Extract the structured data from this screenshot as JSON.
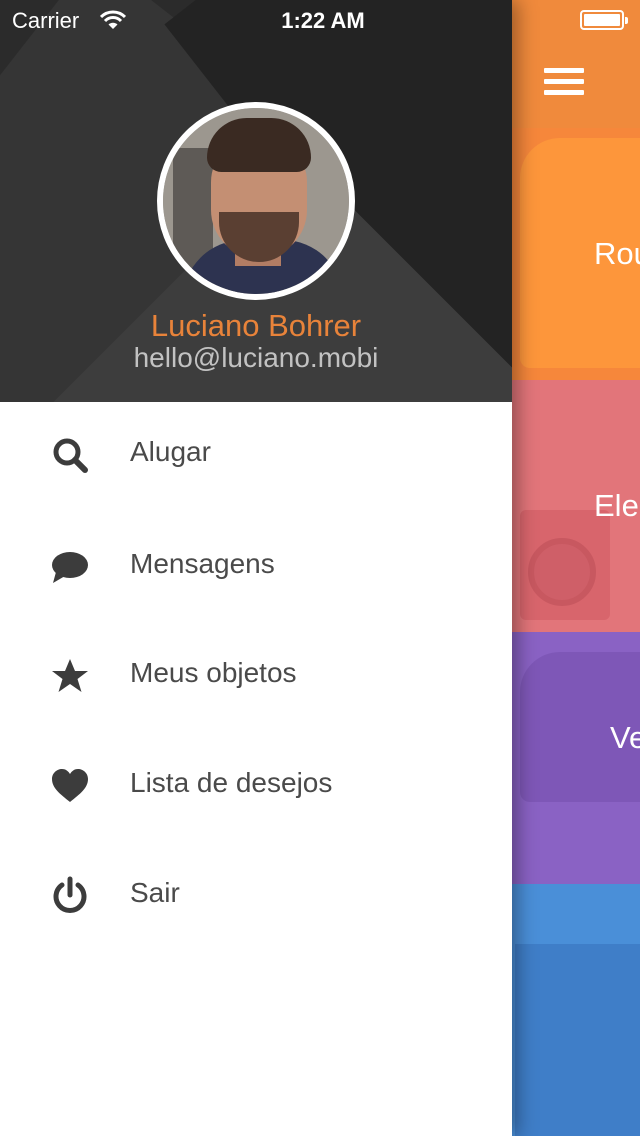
{
  "status_bar": {
    "carrier": "Carrier",
    "time": "1:22 AM"
  },
  "profile": {
    "name": "Luciano Bohrer",
    "email": "hello@luciano.mobi"
  },
  "menu": [
    {
      "label": "Alugar",
      "icon": "search-icon"
    },
    {
      "label": "Mensagens",
      "icon": "chat-bubble-icon"
    },
    {
      "label": "Meus objetos",
      "icon": "star-icon"
    },
    {
      "label": "Lista de desejos",
      "icon": "heart-icon"
    },
    {
      "label": "Sair",
      "icon": "power-icon"
    }
  ],
  "categories": [
    {
      "label": "Rou",
      "color": "#f6873b"
    },
    {
      "label": "Ele",
      "color": "#e2757a"
    },
    {
      "label": "Ve",
      "color": "#8a62c4"
    },
    {
      "label": "",
      "color": "#4a8fd8"
    }
  ],
  "colors": {
    "accent": "#f08a3c",
    "name": "#e8833a",
    "icon": "#3c3c3c"
  }
}
